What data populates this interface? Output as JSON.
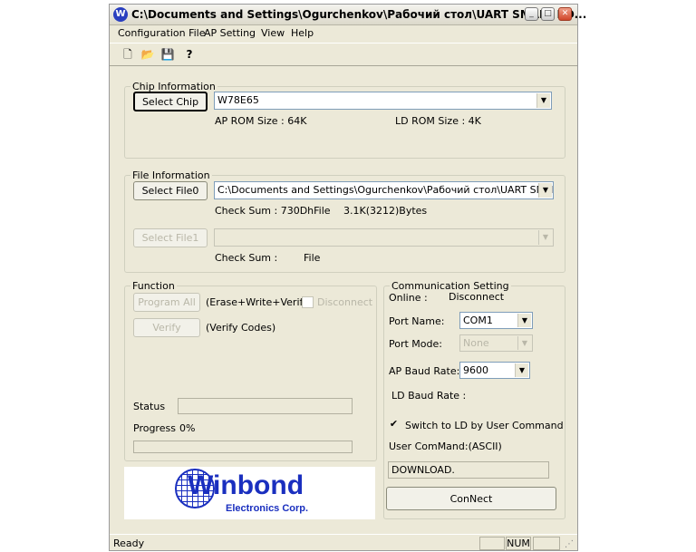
{
  "title": "C:\\Documents and Settings\\Ogurchenkov\\Рабочий стол\\UART SMALL BO...",
  "app_icon": "W",
  "menu": [
    "Configuration File",
    "AP Setting",
    "View",
    "Help"
  ],
  "toolbar_icons": [
    "new-file-icon",
    "open-folder-icon",
    "save-disk-icon",
    "help-icon"
  ],
  "chip": {
    "legend": "Chip Information",
    "select_button": "Select Chip",
    "selected": "W78E65",
    "ap_rom": "AP ROM Size : 64K",
    "ld_rom": "LD ROM Size : 4K"
  },
  "file": {
    "legend": "File Information",
    "file0_button": "Select File0",
    "file0_path": "C:\\Documents and Settings\\Ogurchenkov\\Рабочий стол\\UART SMALL B",
    "checksum0_label": "Check Sum : 730DhFile",
    "size0": "3.1K(3212)Bytes",
    "file1_button": "Select File1",
    "file1_path": "",
    "checksum1_label": "Check Sum :",
    "file1_label": "File"
  },
  "function": {
    "legend": "Function",
    "program_all": "Program All",
    "program_desc": "(Erase+Write+Verify)",
    "disconnect_chk": "Disconnect",
    "verify": "Verify",
    "verify_desc": "(Verify Codes)",
    "status_label": "Status",
    "progress_label": "Progress",
    "progress_value": "0%"
  },
  "comm": {
    "legend": "Communication Setting",
    "online_label": "Online :",
    "online_value": "Disconnect",
    "port_name_label": "Port Name:",
    "port_name": "COM1",
    "port_mode_label": "Port Mode:",
    "port_mode": "None",
    "ap_baud_label": "AP Baud Rate:",
    "ap_baud": "9600",
    "ld_baud_label": "LD Baud Rate :",
    "switch_label": "Switch to LD by User Command",
    "switch_checked": true,
    "user_cmd_label": "User ComMand:(ASCII)",
    "user_cmd_value": "DOWNLOAD.",
    "connect_button": "ConNect"
  },
  "logo": {
    "brand": "Winbond",
    "sub": "Electronics Corp.",
    "color": "#1a2fbf"
  },
  "statusbar": {
    "text": "Ready",
    "num": "NUM"
  }
}
